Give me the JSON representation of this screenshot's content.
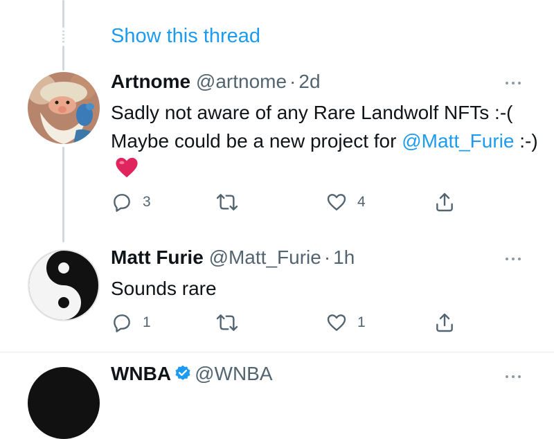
{
  "thread": {
    "show_thread_label": "Show this thread"
  },
  "tweets": [
    {
      "name": "Artnome",
      "handle": "@artnome",
      "separator": "·",
      "time": "2d",
      "text_before": "Sadly not aware of any Rare Landwolf NFTs :-( Maybe could be a new project for ",
      "mention": "@Matt_Furie",
      "text_after": " :-)",
      "emoji": "heart-emoji",
      "replies": "3",
      "retweets": "",
      "likes": "4"
    },
    {
      "name": "Matt Furie",
      "handle": "@Matt_Furie",
      "separator": "·",
      "time": "1h",
      "text": "Sounds rare",
      "replies": "1",
      "retweets": "",
      "likes": "1"
    }
  ],
  "next_tweet": {
    "name": "WNBA",
    "handle": "@WNBA",
    "verified": true
  },
  "colors": {
    "accent": "#1d9bf0",
    "muted": "#536471",
    "heart": "#e0245e",
    "divider": "#e6ecf0"
  },
  "icons": [
    "reply-icon",
    "retweet-icon",
    "like-icon",
    "share-icon",
    "more-icon",
    "verified-icon"
  ]
}
